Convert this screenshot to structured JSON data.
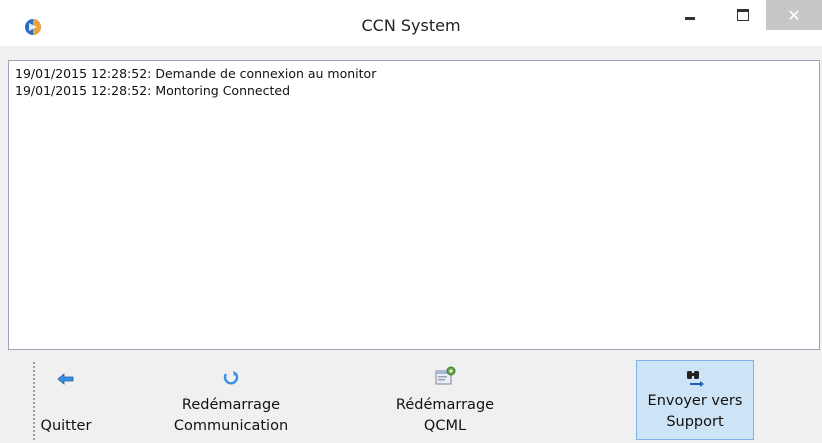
{
  "window": {
    "title": "CCN System",
    "controls": {
      "minimize": "minimize",
      "maximize": "maximize",
      "close": "✕"
    }
  },
  "log": {
    "lines": [
      "19/01/2015 12:28:52: Demande de connexion au monitor",
      "19/01/2015 12:28:52: Montoring Connected"
    ]
  },
  "toolbar": {
    "buttons": [
      {
        "label": "Quitter",
        "icon": "back-arrow-icon"
      },
      {
        "label": "Redémarrage\nCommunication",
        "icon": "refresh-icon"
      },
      {
        "label": "Rédémarrage\nQCML",
        "icon": "settings-window-icon"
      },
      {
        "label": "Envoyer vers\nSupport",
        "icon": "binoculars-send-icon"
      }
    ]
  },
  "colors": {
    "title_bar": "#ffffff",
    "close_button": "#c7c7c7",
    "selected_button": "#cde4f7",
    "selected_border": "#7eb4ea"
  }
}
